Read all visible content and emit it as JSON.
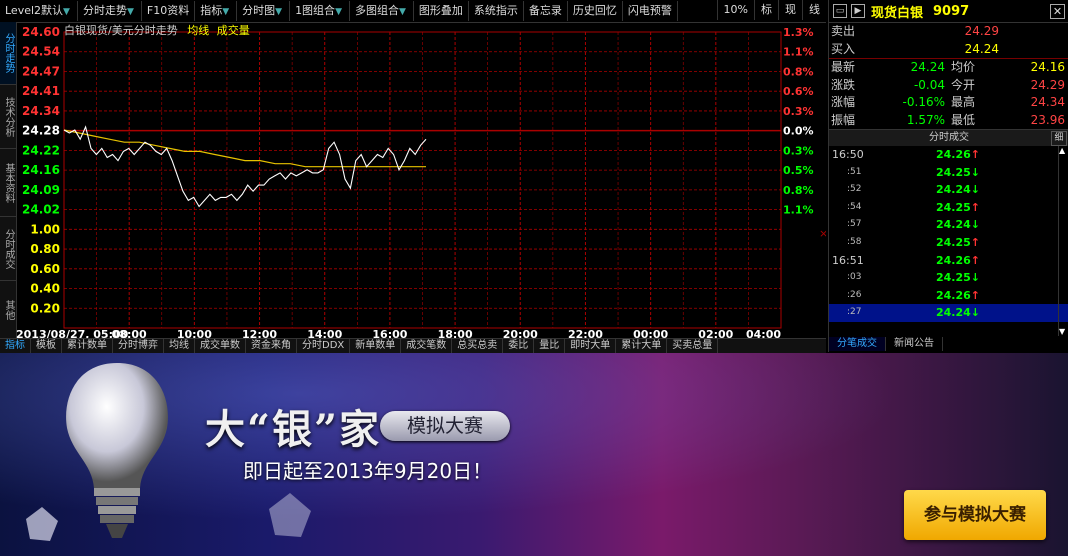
{
  "toolbar": {
    "items": [
      {
        "label": "Level2默认",
        "arrow": true
      },
      {
        "label": "分时走势",
        "arrow": true
      },
      {
        "label": "F10资料",
        "arrow": false
      },
      {
        "label": "指标",
        "arrow": true
      },
      {
        "label": "分时图",
        "arrow": true
      },
      {
        "label": "1图组合",
        "arrow": true
      },
      {
        "label": "多图组合",
        "arrow": true
      },
      {
        "label": "图形叠加",
        "arrow": false
      },
      {
        "label": "系统指示",
        "arrow": false
      },
      {
        "label": "备忘录",
        "arrow": false
      },
      {
        "label": "历史回忆",
        "arrow": false
      },
      {
        "label": "闪电预警",
        "arrow": false
      }
    ],
    "right": [
      "10%",
      "标",
      "现",
      "线"
    ]
  },
  "left_tabs": [
    "分时走势",
    "技术分析",
    "基本资料",
    "分时成交",
    "其他"
  ],
  "chart_header": {
    "instrument": "白银现货/美元分时走势",
    "avg_label": "均线",
    "vol_label": "成交量"
  },
  "chart_data": {
    "type": "line",
    "y_left_ticks": [
      "24.60",
      "24.54",
      "24.47",
      "24.41",
      "24.34",
      "24.28",
      "24.22",
      "24.16",
      "24.09",
      "24.02",
      "1.00",
      "0.80",
      "0.60",
      "0.40",
      "0.20"
    ],
    "y_right_ticks": [
      "1.3%",
      "1.1%",
      "0.8%",
      "0.6%",
      "0.3%",
      "0.0%",
      "0.3%",
      "0.5%",
      "0.8%",
      "1.1%"
    ],
    "x_ticks": [
      "2013/08/27, 05:00",
      "08:00",
      "10:00",
      "12:00",
      "14:00",
      "16:00",
      "18:00",
      "20:00",
      "22:00",
      "00:00",
      "02:00",
      "04:00"
    ],
    "reference_price": 24.28,
    "price_range": [
      23.96,
      24.6
    ],
    "series": [
      {
        "values": [
          24.28,
          24.27,
          24.28,
          24.25,
          24.29,
          24.22,
          24.2,
          24.22,
          24.19,
          24.2,
          24.18,
          24.21,
          24.22,
          24.2,
          24.22,
          24.24,
          24.23,
          24.21,
          24.2,
          24.22,
          24.18,
          24.13,
          24.08,
          24.05,
          24.06,
          24.03,
          24.05,
          24.07,
          24.05,
          24.06,
          24.06,
          24.07,
          24.05,
          24.07,
          24.1,
          24.08,
          24.1,
          24.1,
          24.12,
          24.13,
          24.14,
          24.12,
          24.14,
          24.13,
          24.14,
          24.15,
          24.14,
          24.14,
          24.15,
          24.22,
          24.24,
          24.2,
          24.12,
          24.09,
          24.18,
          24.2,
          24.16,
          24.18,
          24.2,
          24.19,
          24.22,
          24.2,
          24.15,
          24.18,
          24.22,
          24.2,
          24.23,
          24.25
        ]
      },
      {
        "values": [
          24.28,
          24.27,
          24.26,
          24.25,
          24.24,
          24.24,
          24.23,
          24.22,
          24.21,
          24.21,
          24.2,
          24.19,
          24.18,
          24.18,
          24.17,
          24.17,
          24.16,
          24.16,
          24.16,
          24.16,
          24.16,
          24.16,
          24.16,
          24.16,
          24.16
        ]
      }
    ],
    "grid": true
  },
  "quote": {
    "name": "现货白银",
    "code": "9097",
    "sell_label": "卖出",
    "sell_value": "24.29",
    "buy_label": "买入",
    "buy_value": "24.24",
    "rows": [
      {
        "l1": "最新",
        "v1": "24.24",
        "l2": "均价",
        "v2": "24.16"
      },
      {
        "l1": "涨跌",
        "v1": "-0.04",
        "l2": "今开",
        "v2": "24.29"
      },
      {
        "l1": "涨幅",
        "v1": "-0.16%",
        "l2": "最高",
        "v2": "24.34"
      },
      {
        "l1": "振幅",
        "v1": "1.57%",
        "l2": "最低",
        "v2": "23.96"
      }
    ],
    "trades_title": "分时成交",
    "trades_detail": "细",
    "trades": [
      {
        "t": "16:50",
        "p": "24.26",
        "dir": "up",
        "main": true
      },
      {
        "t": ":51",
        "p": "24.25",
        "dir": "down",
        "main": false
      },
      {
        "t": ":52",
        "p": "24.24",
        "dir": "down",
        "main": false
      },
      {
        "t": ":54",
        "p": "24.25",
        "dir": "up",
        "main": false
      },
      {
        "t": ":57",
        "p": "24.24",
        "dir": "down",
        "main": false
      },
      {
        "t": ":58",
        "p": "24.25",
        "dir": "up",
        "main": false
      },
      {
        "t": "16:51",
        "p": "24.26",
        "dir": "up",
        "main": true
      },
      {
        "t": ":03",
        "p": "24.25",
        "dir": "down",
        "main": false
      },
      {
        "t": ":26",
        "p": "24.26",
        "dir": "up",
        "main": false
      },
      {
        "t": ":27",
        "p": "24.24",
        "dir": "down",
        "main": false,
        "selected": true
      }
    ],
    "bottom_tabs": [
      "分笔成交",
      "新闻公告"
    ]
  },
  "bottom_tabs": [
    "指标",
    "模板",
    "累计数单",
    "分时博弈",
    "均线",
    "成交单数",
    "资金来角",
    "分时DDX",
    "新单数单",
    "成交笔数",
    "总买总卖",
    "委比",
    "量比",
    "即时大单",
    "累计大单",
    "买卖总量"
  ],
  "banner": {
    "title": "大“银”家",
    "pill": "模拟大赛",
    "date": "即日起至2013年9月20日！",
    "cta": "参与模拟大赛"
  },
  "colors": {
    "grid": "#aa0000",
    "price_line": "#ffffff",
    "avg_line": "#e6c200",
    "up": "#ff3333",
    "down": "#00ff00"
  }
}
